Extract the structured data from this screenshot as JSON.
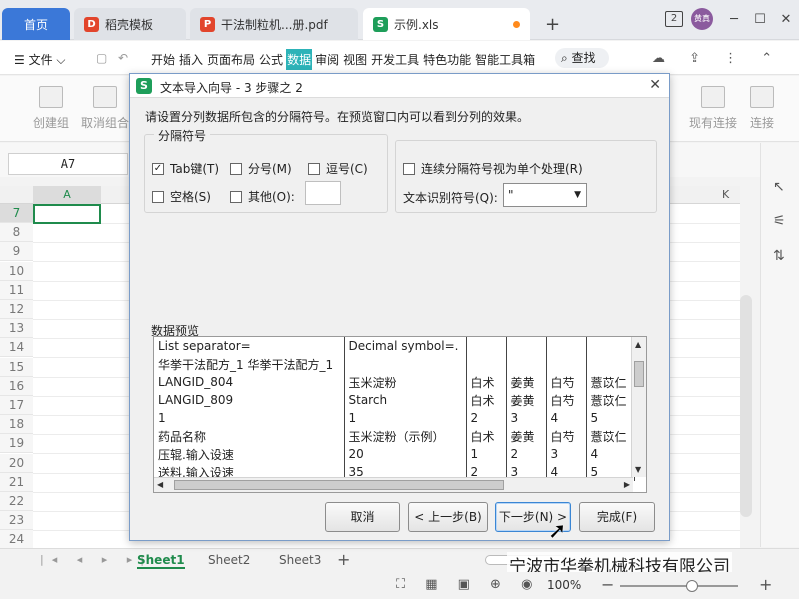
{
  "tabs": {
    "home": "首页",
    "t1": "稻壳模板",
    "t2": "干法制粒机...册.pdf",
    "t3": "示例.xls",
    "window_count": "2",
    "avatar": "黄真"
  },
  "menu": {
    "file": "文件",
    "items": [
      "开始",
      "插入",
      "页面布局",
      "公式",
      "数据",
      "审阅",
      "视图",
      "开发工具",
      "特色功能",
      "智能工具箱"
    ],
    "search": "查找"
  },
  "ribbon": {
    "create_group": "创建组",
    "cancel_group": "取消组合",
    "existing": "现有连接",
    "connect": "连接"
  },
  "namebox": "A7",
  "columns": {
    "a": "A",
    "k": "K"
  },
  "rows": [
    "7",
    "8",
    "9",
    "10",
    "11",
    "12",
    "13",
    "14",
    "15",
    "16",
    "17",
    "18",
    "19",
    "20",
    "21",
    "22",
    "23",
    "24"
  ],
  "sheets": [
    "Sheet1",
    "Sheet2",
    "Sheet3"
  ],
  "status": {
    "zoom": "100%"
  },
  "watermark": "宁波市华拳机械科技有限公司",
  "dialog": {
    "title": "文本导入向导 - 3 步骤之 2",
    "description": "请设置分列数据所包含的分隔符号。在预览窗口内可以看到分列的效果。",
    "sep_group": "分隔符号",
    "tab": "Tab键(T)",
    "semicolon": "分号(M)",
    "comma": "逗号(C)",
    "space": "空格(S)",
    "other": "其他(O):",
    "consecutive": "连续分隔符号视为单个处理(R)",
    "qualifier_label": "文本识别符号(Q):",
    "qualifier_value": "\"",
    "preview_label": "数据预览",
    "preview_rows": [
      [
        "List separator=",
        "Decimal symbol=.",
        "",
        "",
        "",
        ""
      ],
      [
        "华挙干法配方_1 华挙干法配方_1",
        "",
        "",
        "",
        "",
        ""
      ],
      [
        "LANGID_804",
        "玉米淀粉",
        "白术",
        "姜黄",
        "白芍",
        "薏苡仁"
      ],
      [
        "LANGID_809",
        "Starch",
        "白术",
        "姜黄",
        "白芍",
        "薏苡仁"
      ],
      [
        "1",
        "1",
        "2",
        "3",
        "4",
        "5"
      ],
      [
        "药品名称",
        "玉米淀粉（示例）",
        "白术",
        "姜黄",
        "白芍",
        "薏苡仁"
      ],
      [
        "压辊.输入设速",
        "20",
        "1",
        "2",
        "3",
        "4"
      ],
      [
        "送料.输入设速",
        "35",
        "2",
        "3",
        "4",
        "5"
      ]
    ],
    "buttons": {
      "cancel": "取消",
      "back": "< 上一步(B)",
      "next": "下一步(N) >",
      "finish": "完成(F)"
    }
  }
}
